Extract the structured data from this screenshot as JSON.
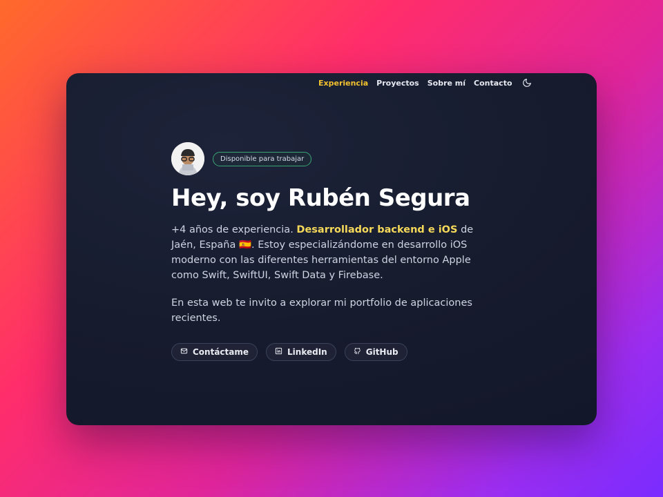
{
  "nav": {
    "items": [
      {
        "label": "Experiencia",
        "active": true
      },
      {
        "label": "Proyectos",
        "active": false
      },
      {
        "label": "Sobre mí",
        "active": false
      },
      {
        "label": "Contacto",
        "active": false
      }
    ],
    "theme_icon": "moon-icon"
  },
  "hero": {
    "badge": "Disponible para trabajar",
    "title": "Hey, soy Rubén Segura",
    "intro_before": "+4 años de experiencia.",
    "intro_highlight": "Desarrollador backend e iOS",
    "intro_after": "de Jaén, España 🇪🇸. Estoy especializándome en desarrollo iOS moderno con las diferentes herramientas del entorno Apple como Swift, SwiftUI, Swift Data y Firebase.",
    "paragraph2": "En esta web te invito a explorar mi portfolio de aplicaciones recientes."
  },
  "buttons": [
    {
      "label": "Contáctame",
      "icon": "mail-icon"
    },
    {
      "label": "LinkedIn",
      "icon": "linkedin-icon"
    },
    {
      "label": "GitHub",
      "icon": "github-icon"
    }
  ],
  "colors": {
    "accent": "#f2c12e",
    "highlight": "#f7d95a",
    "badge_border": "#3aa676",
    "card_bg": "#161b2d"
  }
}
